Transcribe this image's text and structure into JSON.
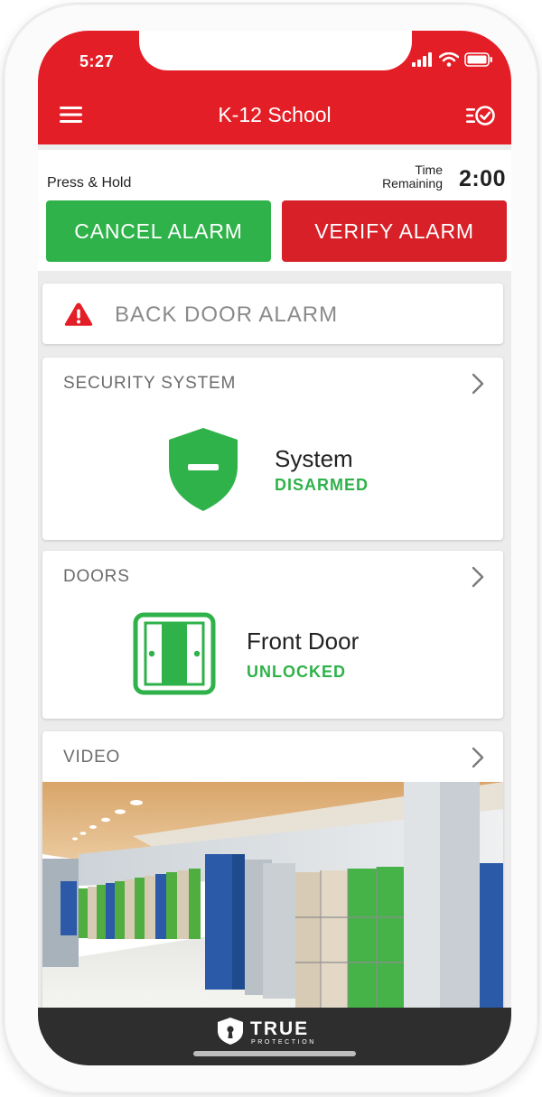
{
  "status_bar": {
    "time": "5:27",
    "icons": [
      "signal-icon",
      "wifi-icon",
      "battery-icon"
    ]
  },
  "header": {
    "title": "K-12 School",
    "left_icon": "menu-icon",
    "right_icon": "history-check-icon",
    "color": "#e41e26"
  },
  "alarm_panel": {
    "hint": "Press & Hold",
    "time_label_line1": "Time",
    "time_label_line2": "Remaining",
    "time_remaining": "2:00",
    "cancel_label": "CANCEL ALARM",
    "verify_label": "VERIFY ALARM",
    "cancel_color": "#2fb24a",
    "verify_color": "#d72027"
  },
  "alert": {
    "icon": "warning-icon",
    "text": "BACK DOOR ALARM"
  },
  "security": {
    "heading": "SECURITY SYSTEM",
    "item_title": "System",
    "item_status": "DISARMED",
    "icon": "shield-icon",
    "status_color": "#2fb24a"
  },
  "doors": {
    "heading": "DOORS",
    "item_title": "Front Door",
    "item_status": "UNLOCKED",
    "icon": "door-icon"
  },
  "video": {
    "heading": "VIDEO",
    "content": "school-hallway-camera-feed"
  },
  "footer": {
    "brand_word": "TRUE",
    "brand_sub": "PROTECTION",
    "logo_icon": "shield-keyhole-logo-icon"
  }
}
